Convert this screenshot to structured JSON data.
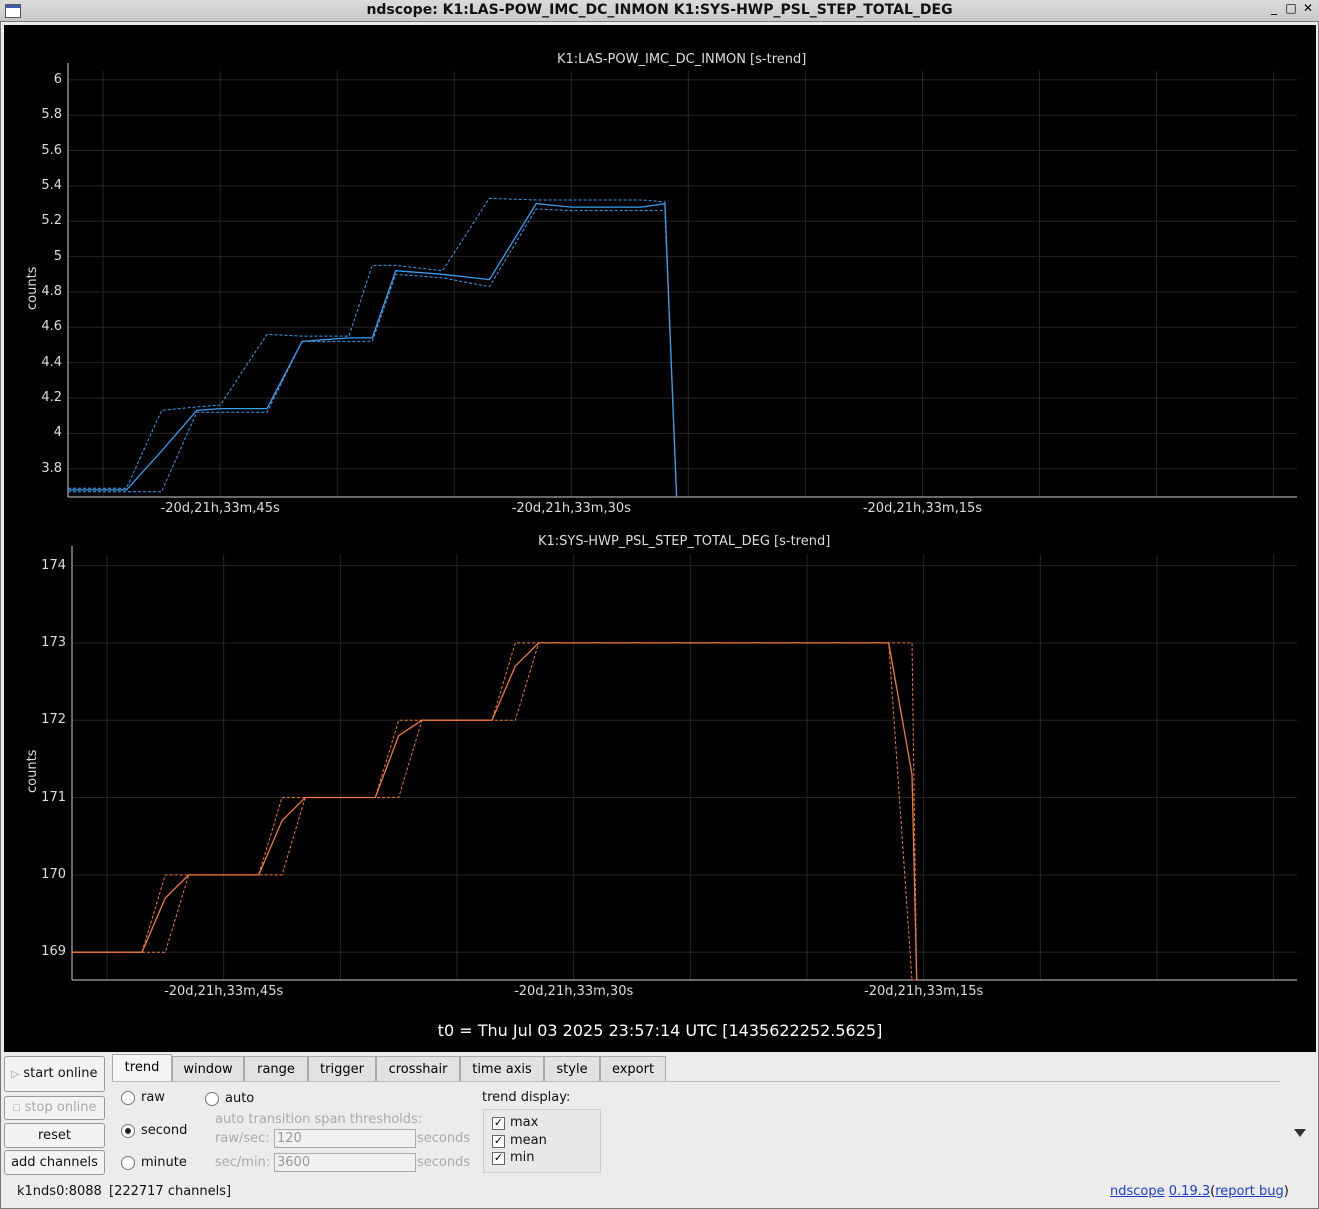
{
  "window": {
    "title": "ndscope: K1:LAS-POW_IMC_DC_INMON K1:SYS-HWP_PSL_STEP_TOTAL_DEG",
    "minimize": "_",
    "maximize": "□",
    "close": "✕"
  },
  "plot1": {
    "title": "K1:LAS-POW_IMC_DC_INMON [s-trend]",
    "ylabel": "counts",
    "yticks": [
      "6",
      "5.8",
      "5.6",
      "5.4",
      "5.2",
      "5",
      "4.8",
      "4.6",
      "4.4",
      "4.2",
      "4",
      "3.8"
    ],
    "xticks": [
      "-20d,21h,33m,45s",
      "-20d,21h,33m,30s",
      "-20d,21h,33m,15s"
    ]
  },
  "plot2": {
    "title": "K1:SYS-HWP_PSL_STEP_TOTAL_DEG [s-trend]",
    "ylabel": "counts",
    "yticks": [
      "174",
      "173",
      "172",
      "171",
      "170",
      "169"
    ],
    "xticks": [
      "-20d,21h,33m,45s",
      "-20d,21h,33m,30s",
      "-20d,21h,33m,15s"
    ]
  },
  "chart_data": [
    {
      "type": "line",
      "title": "K1:LAS-POW_IMC_DC_INMON [s-trend]",
      "ylabel": "counts",
      "ylim": [
        3.64,
        6.05
      ],
      "color": "#3a9ff0",
      "x_unit": "seconds relative to t0",
      "xlim": [
        -51.5,
        1
      ],
      "x": [
        -51.5,
        -49.0,
        -47.5,
        -46.0,
        -45.0,
        -43.0,
        -41.5,
        -39.5,
        -38.5,
        -37.5,
        -35.5,
        -33.5,
        -31.5,
        -30.0,
        -27.0,
        -26.0,
        -25.5
      ],
      "mean": [
        3.68,
        3.68,
        3.9,
        4.13,
        4.14,
        4.14,
        4.52,
        4.54,
        4.54,
        4.92,
        4.9,
        4.87,
        5.3,
        5.28,
        5.28,
        5.3,
        3.64
      ],
      "max": [
        3.69,
        3.69,
        4.13,
        4.15,
        4.16,
        4.56,
        4.55,
        4.55,
        4.95,
        4.95,
        4.92,
        5.33,
        5.32,
        5.32,
        5.32,
        5.31,
        3.64
      ],
      "min": [
        3.67,
        3.67,
        3.67,
        4.12,
        4.12,
        4.12,
        4.52,
        4.52,
        4.52,
        4.9,
        4.88,
        4.83,
        5.27,
        5.26,
        5.26,
        5.26,
        3.64
      ]
    },
    {
      "type": "line",
      "title": "K1:SYS-HWP_PSL_STEP_TOTAL_DEG [s-trend]",
      "ylabel": "counts",
      "ylim": [
        168.64,
        174.15
      ],
      "color": "#f07a3a",
      "x_unit": "seconds relative to t0",
      "xlim": [
        -51.5,
        1
      ],
      "x": [
        -51.5,
        -48.5,
        -47.5,
        -46.5,
        -43.5,
        -42.5,
        -41.5,
        -38.5,
        -37.5,
        -36.5,
        -33.5,
        -32.5,
        -31.5,
        -16.5,
        -15.5,
        -15.3
      ],
      "mean": [
        169,
        169,
        169.7,
        170,
        170,
        170.7,
        171,
        171,
        171.8,
        172,
        172,
        172.7,
        173,
        173,
        171.3,
        168.64
      ],
      "max": [
        169,
        169,
        170,
        170,
        170,
        171,
        171,
        171,
        172,
        172,
        172,
        173,
        173,
        173,
        173,
        168.64
      ],
      "min": [
        169,
        169,
        169,
        170,
        170,
        170,
        171,
        171,
        171,
        172,
        172,
        172,
        173,
        173,
        168.64,
        168.64
      ]
    }
  ],
  "t0_label": "t0 = Thu Jul 03 2025 23:57:14 UTC [1435622252.5625]",
  "controls": {
    "start_online": "start online",
    "stop_online": "stop online",
    "reset": "reset",
    "add_channels": "add channels",
    "tabs": [
      "trend",
      "window",
      "range",
      "trigger",
      "crosshair",
      "time axis",
      "style",
      "export"
    ],
    "active_tab": "trend",
    "trend": {
      "raw": "raw",
      "second": "second",
      "minute": "minute",
      "auto": "auto",
      "selected": "second",
      "thresholds_label": "auto transition span thresholds:",
      "raw_sec_label": "raw/sec:",
      "raw_sec_value": "120",
      "sec_min_label": "sec/min:",
      "sec_min_value": "3600",
      "seconds": "seconds",
      "display_label": "trend display:",
      "display": [
        {
          "label": "max",
          "checked": true
        },
        {
          "label": "mean",
          "checked": true
        },
        {
          "label": "min",
          "checked": true
        }
      ]
    }
  },
  "status": {
    "server": "k1nds0:8088",
    "channels": "[222717 channels]",
    "app_name": "ndscope",
    "version": "0.19.3",
    "report_open": "(",
    "report_bug": "report bug",
    "report_close": ")"
  },
  "colors": {
    "plot_bg": "#000000",
    "grid": "#2a2a2a",
    "series1": "#3a9ff0",
    "series2": "#f07a3a"
  }
}
